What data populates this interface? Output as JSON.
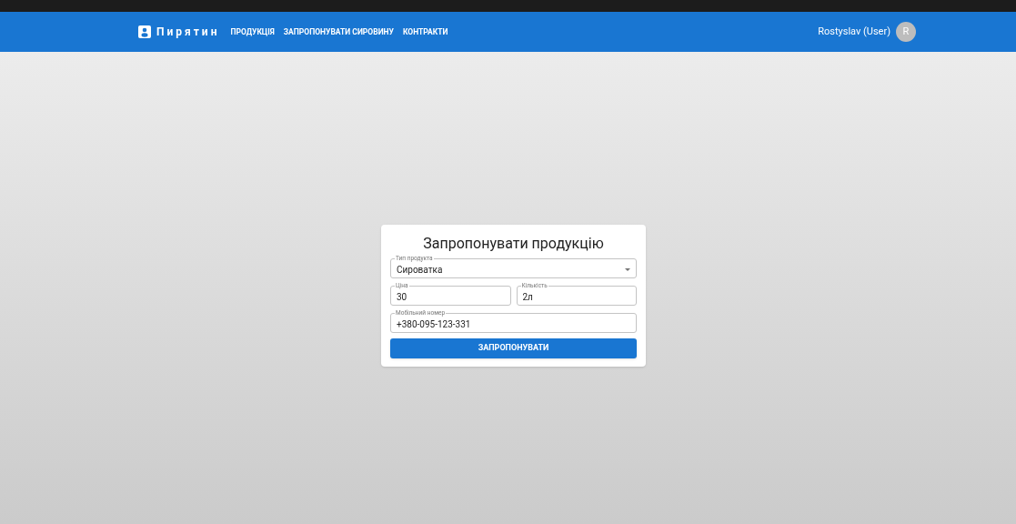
{
  "app_bar": {
    "brand": "Пирятин",
    "nav": [
      "ПРОДУКЦІЯ",
      "ЗАПРОПОНУВАТИ СИРОВИНУ",
      "КОНТРАКТИ"
    ],
    "user": "Rostyslav (User)",
    "avatar": "R"
  },
  "form": {
    "title": "Запропонувати продукцію",
    "fields": [
      {
        "kind": "select",
        "label": "Тип продукта",
        "value": "Сироватка"
      },
      {
        "kind": "text",
        "label": "Ціна",
        "value": "30"
      },
      {
        "kind": "text",
        "label": "Кількість",
        "value": "2л"
      },
      {
        "kind": "text",
        "label": "Мобільний номер",
        "value": "+380-095-123-331"
      }
    ],
    "submit": "ЗАПРОПОНУВАТИ"
  }
}
